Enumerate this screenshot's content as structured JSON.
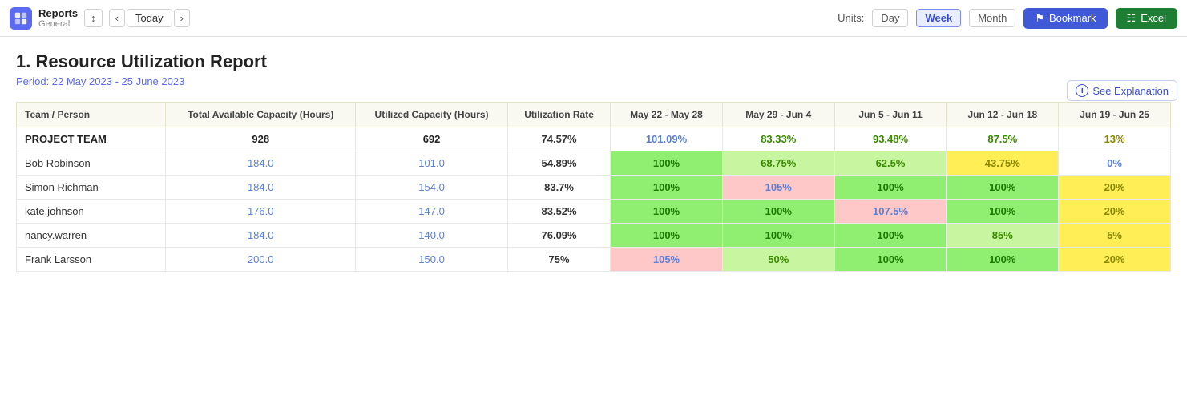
{
  "nav": {
    "app_name": "Reports",
    "app_subtitle": "General",
    "today_label": "Today",
    "units_label": "Units:",
    "unit_day": "Day",
    "unit_week": "Week",
    "unit_month": "Month",
    "bookmark_label": "Bookmark",
    "excel_label": "Excel"
  },
  "page": {
    "title": "1. Resource Utilization Report",
    "period": "Period: 22 May 2023 - 25 June 2023",
    "see_explanation": "See Explanation"
  },
  "table": {
    "columns": {
      "team_person": "Team / Person",
      "total_available": "Total Available Capacity (Hours)",
      "utilized_capacity": "Utilized Capacity (Hours)",
      "utilization_rate": "Utilization Rate",
      "week1": "May 22 - May 28",
      "week2": "May 29 - Jun 4",
      "week3": "Jun 5 - Jun 11",
      "week4": "Jun 12 - Jun 18",
      "week5": "Jun 19 - Jun 25"
    },
    "rows": [
      {
        "name": "PROJECT TEAM",
        "total": "928",
        "utilized": "692",
        "rate": "74.57%",
        "w1": "101.09%",
        "w1_type": "pink",
        "w2": "83.33%",
        "w2_type": "light-green",
        "w3": "93.48%",
        "w3_type": "light-green",
        "w4": "87.5%",
        "w4_type": "light-green",
        "w5": "13%",
        "w5_type": "yellow",
        "is_team": true
      },
      {
        "name": "Bob Robinson",
        "total": "184.0",
        "utilized": "101.0",
        "rate": "54.89%",
        "w1": "100%",
        "w1_type": "green",
        "w2": "68.75%",
        "w2_type": "light-green",
        "w3": "62.5%",
        "w3_type": "light-green",
        "w4": "43.75%",
        "w4_type": "yellow",
        "w5": "0%",
        "w5_type": "white",
        "is_team": false
      },
      {
        "name": "Simon Richman",
        "total": "184.0",
        "utilized": "154.0",
        "rate": "83.7%",
        "w1": "100%",
        "w1_type": "green",
        "w2": "105%",
        "w2_type": "pink",
        "w3": "100%",
        "w3_type": "green",
        "w4": "100%",
        "w4_type": "green",
        "w5": "20%",
        "w5_type": "yellow",
        "is_team": false
      },
      {
        "name": "kate.johnson",
        "total": "176.0",
        "utilized": "147.0",
        "rate": "83.52%",
        "w1": "100%",
        "w1_type": "green",
        "w2": "100%",
        "w2_type": "green",
        "w3": "107.5%",
        "w3_type": "pink",
        "w4": "100%",
        "w4_type": "green",
        "w5": "20%",
        "w5_type": "yellow",
        "is_team": false
      },
      {
        "name": "nancy.warren",
        "total": "184.0",
        "utilized": "140.0",
        "rate": "76.09%",
        "w1": "100%",
        "w1_type": "green",
        "w2": "100%",
        "w2_type": "green",
        "w3": "100%",
        "w3_type": "green",
        "w4": "85%",
        "w4_type": "light-green",
        "w5": "5%",
        "w5_type": "yellow",
        "is_team": false
      },
      {
        "name": "Frank Larsson",
        "total": "200.0",
        "utilized": "150.0",
        "rate": "75%",
        "w1": "105%",
        "w1_type": "pink",
        "w2": "50%",
        "w2_type": "light-green",
        "w3": "100%",
        "w3_type": "green",
        "w4": "100%",
        "w4_type": "green",
        "w5": "20%",
        "w5_type": "yellow",
        "is_team": false
      }
    ]
  }
}
